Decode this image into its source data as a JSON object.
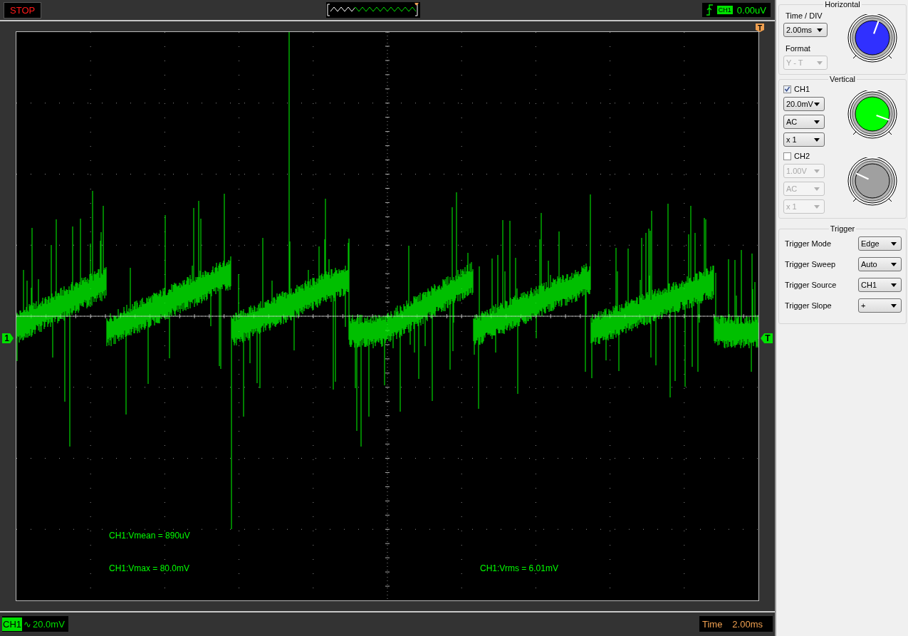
{
  "top_bar": {
    "run_state": "STOP",
    "trigger_readout": {
      "channel": "CH1",
      "level": "0.00uV"
    }
  },
  "screen": {
    "channel_marker": "1",
    "trigger_level_marker": "T",
    "trigger_position_marker": "T",
    "measurements": [
      {
        "text": "CH1:Vmean = 890uV"
      },
      {
        "text": "CH1:Vmax = 80.0mV"
      },
      {
        "text": "CH1:Vrms = 6.01mV"
      }
    ]
  },
  "status_bar": {
    "channel": "CH1",
    "coupling_symbol": "∿",
    "volts_per_div": "20.0mV",
    "time_label": "Time",
    "time_per_div": "2.00ms"
  },
  "horizontal": {
    "title": "Horizontal",
    "time_div_label": "Time / DIV",
    "time_div": {
      "value": "2.00ms",
      "disabled": false
    },
    "format_label": "Format",
    "format": {
      "value": "Y - T",
      "disabled": true
    }
  },
  "vertical": {
    "title": "Vertical",
    "channels": [
      {
        "label": "CH1",
        "checked": true,
        "settings": [
          "20.0mV",
          "AC",
          "x 1"
        ]
      },
      {
        "label": "CH2",
        "checked": false,
        "settings": [
          "1.00V",
          "AC",
          "x 1"
        ]
      }
    ]
  },
  "trigger": {
    "title": "Trigger",
    "rows": [
      {
        "label": "Trigger Mode",
        "value": "Edge"
      },
      {
        "label": "Trigger Sweep",
        "value": "Auto"
      },
      {
        "label": "Trigger Source",
        "value": "CH1"
      },
      {
        "label": "Trigger Slope",
        "value": "+"
      }
    ]
  }
}
